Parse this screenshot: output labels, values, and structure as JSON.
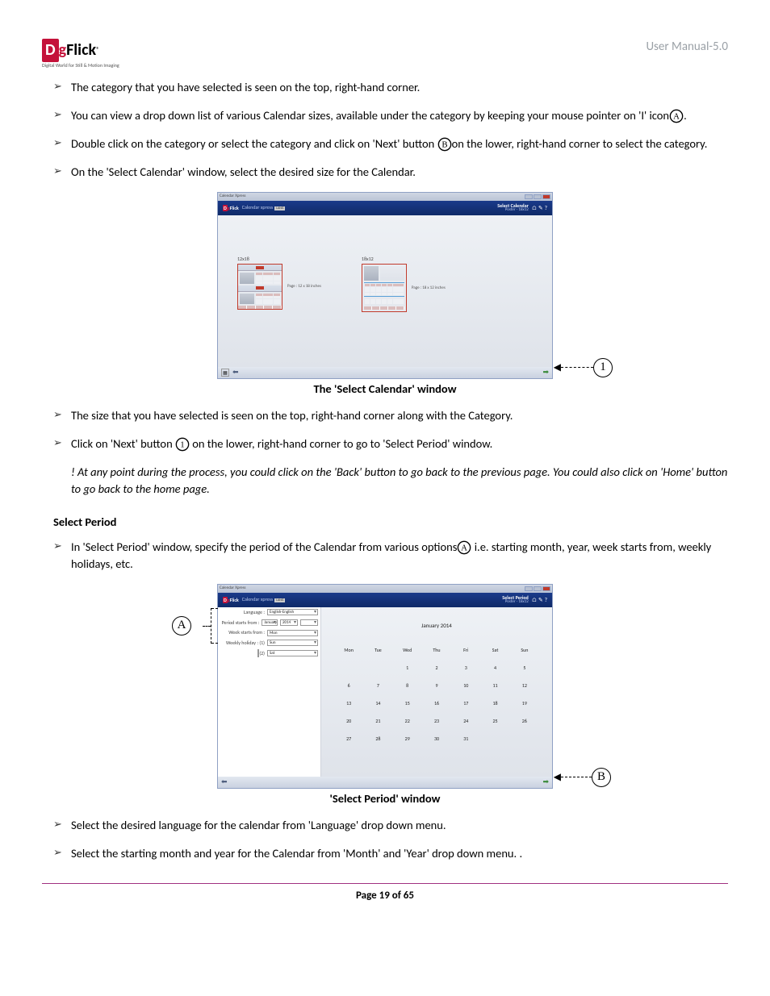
{
  "header": {
    "logo_main": "DgFlick",
    "logo_sub": "Digital World for Still & Motion Imaging",
    "version": "User Manual-5.0"
  },
  "bullets_top": [
    "The category that you have selected is seen on the top, right-hand corner.",
    "You can view a drop down list of various Calendar sizes, available under the category by keeping your mouse pointer on 'I' icon",
    "Double click on the category or select the category and click on 'Next' button ",
    "on the lower, right-hand corner to select the category.",
    "On the 'Select Calendar' window, select the desired size for the Calendar."
  ],
  "fig1": {
    "caption": "The 'Select Calendar' window",
    "win_title": "Calendar Xpress",
    "brand": "Calendar xpress",
    "lang_tag": "LANG",
    "right_main": "Select Calendar",
    "right_sub": "Poster - 18x12",
    "card1_label": "12x18",
    "card1_page": "Page : 12 x 18 inches",
    "card2_label": "18x12",
    "card2_page": "Page : 18 x 12 inches",
    "annot_label": "1"
  },
  "bullets_mid": [
    "The size that you have selected is seen on the top, right-hand corner along with the Category.",
    "Click on 'Next' button ",
    " on the lower, right-hand corner to go to 'Select Period' window."
  ],
  "note": "! At any point during the process, you could click on the 'Back' button to go back to the previous page. You could also click on 'Home' button to go back to the home page.",
  "section": "Select Period",
  "bullets_sp": [
    "In 'Select Period' window, specify the period of the Calendar from various options",
    " i.e. starting month, year, week starts from, weekly holidays, etc."
  ],
  "fig2": {
    "caption": "'Select Period' window",
    "win_title": "Calendar Xpress",
    "right_main": "Select Period",
    "right_sub": "Poster - 18x12",
    "form": {
      "lang_lbl": "Language :",
      "lang_val": "English-English",
      "period_lbl": "Period starts from :",
      "period_val": "January",
      "year_val": "2014",
      "week_lbl": "Week starts from :",
      "week_val": "Mon",
      "holiday_lbl": "Weekly holiday : (1)",
      "holiday_val": "Sun",
      "h2_lbl": "(2)",
      "h2_val": "Sat"
    },
    "cal_title": "January 2014",
    "cal_headers": [
      "Mon",
      "Tue",
      "Wed",
      "Thu",
      "Fri",
      "Sat",
      "Sun"
    ],
    "cal_rows": [
      [
        "",
        "",
        "1",
        "2",
        "3",
        "4",
        "5"
      ],
      [
        "6",
        "7",
        "8",
        "9",
        "10",
        "11",
        "12"
      ],
      [
        "13",
        "14",
        "15",
        "16",
        "17",
        "18",
        "19"
      ],
      [
        "20",
        "21",
        "22",
        "23",
        "24",
        "25",
        "26"
      ],
      [
        "27",
        "28",
        "29",
        "30",
        "31",
        "",
        ""
      ]
    ],
    "annot_A": "A",
    "annot_B": "B"
  },
  "bullets_bot": [
    "Select the desired language for the calendar from 'Language' drop down menu.",
    "Select the starting month and year for the Calendar from 'Month' and 'Year' drop down menu. ."
  ],
  "footer": {
    "pre": "Page ",
    "num": "19",
    "of": " of ",
    "total": "65"
  },
  "icons": {
    "A": "A",
    "B": "B",
    "one": "1"
  }
}
